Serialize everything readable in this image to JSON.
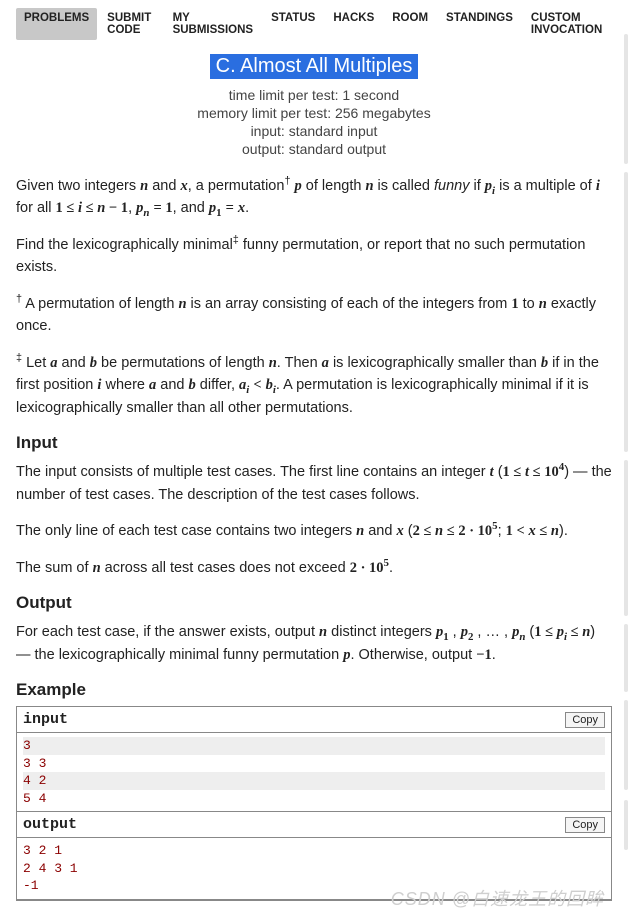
{
  "nav": {
    "items": [
      {
        "label": "PROBLEMS",
        "active": true
      },
      {
        "label": "SUBMIT CODE",
        "active": false
      },
      {
        "label": "MY SUBMISSIONS",
        "active": false
      },
      {
        "label": "STATUS",
        "active": false
      },
      {
        "label": "HACKS",
        "active": false
      },
      {
        "label": "ROOM",
        "active": false
      },
      {
        "label": "STANDINGS",
        "active": false
      },
      {
        "label": "CUSTOM INVOCATION",
        "active": false
      }
    ]
  },
  "header": {
    "title": "C. Almost All Multiples",
    "time_limit": "time limit per test: 1 second",
    "memory_limit": "memory limit per test: 256 megabytes",
    "input_spec": "input: standard input",
    "output_spec": "output: standard output"
  },
  "sections": {
    "input_title": "Input",
    "output_title": "Output",
    "example_title": "Example"
  },
  "example": {
    "input_label": "input",
    "output_label": "output",
    "copy_label": "Copy",
    "input_lines": [
      "3",
      "3 3",
      "4 2",
      "5 4"
    ],
    "output_lines": [
      "3 2 1",
      "2 4 3 1",
      "-1"
    ]
  },
  "watermark": "CSDN @白速龙王的回眸"
}
